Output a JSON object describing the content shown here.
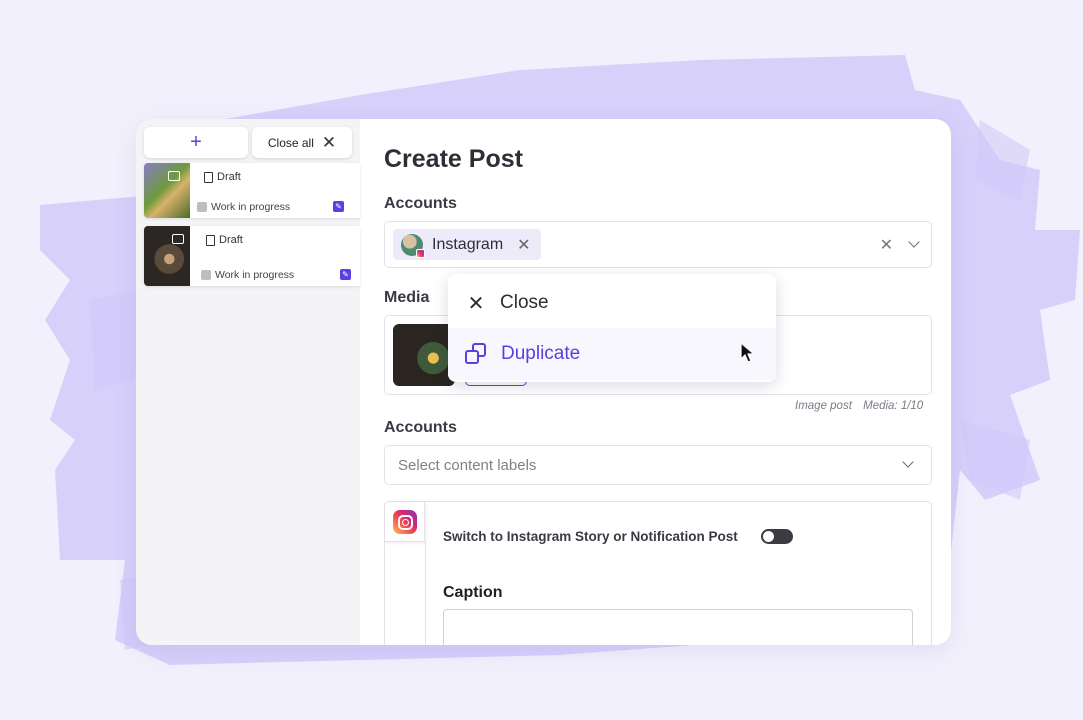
{
  "sidebar": {
    "add_label": "+",
    "close_all_label": "Close all",
    "close_all_icon": "✕",
    "drafts": [
      {
        "type": "Draft",
        "status": "Work in progress"
      },
      {
        "type": "Draft",
        "status": "Work in progress"
      }
    ]
  },
  "form": {
    "title": "Create Post",
    "accounts_label": "Accounts",
    "selected_account": "Instagram",
    "chip_remove": "✕",
    "clear_icon": "✕",
    "media_label": "Media",
    "media_post_type": "Image post",
    "media_count": "Media: 1/10",
    "labels_label": "Accounts",
    "labels_placeholder": "Select content labels",
    "switch_text": "Switch to Instagram Story or Notification Post",
    "caption_label": "Caption"
  },
  "context_menu": {
    "close_icon": "✕",
    "close_label": "Close",
    "duplicate_label": "Duplicate"
  },
  "colors": {
    "accent": "#5b3fe0",
    "background": "#f1f0fc",
    "brush": "#d7d0fa"
  },
  "toggle_on": false
}
